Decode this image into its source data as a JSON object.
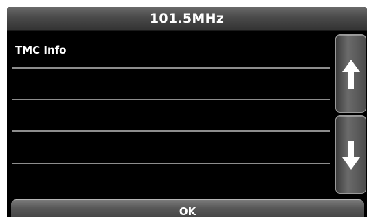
{
  "header": {
    "title": "101.5MHz"
  },
  "list": {
    "rows": [
      {
        "label": "TMC Info"
      },
      {
        "label": ""
      },
      {
        "label": ""
      },
      {
        "label": ""
      }
    ]
  },
  "scroll": {
    "up_icon": "arrow-up-icon",
    "down_icon": "arrow-down-icon"
  },
  "footer": {
    "ok_label": "OK"
  },
  "colors": {
    "background": "#000000",
    "text": "#ffffff",
    "divider": "#8d8d8d",
    "bar": "#4a4a4a"
  }
}
